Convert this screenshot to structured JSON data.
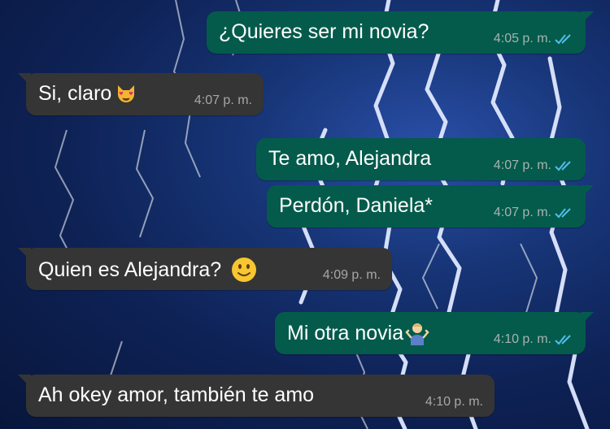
{
  "messages": [
    {
      "direction": "out",
      "text": "¿Quieres ser mi novia?",
      "time": "4:05 p. m.",
      "status": "read",
      "emoji": null
    },
    {
      "direction": "in",
      "text": "Si, claro",
      "time": "4:07 p. m.",
      "emoji": "heart-eyes-cat"
    },
    {
      "direction": "out",
      "text": "Te amo, Alejandra",
      "time": "4:07 p. m.",
      "status": "read",
      "emoji": null
    },
    {
      "direction": "out",
      "text": "Perdón, Daniela*",
      "time": "4:07 p. m.",
      "status": "read",
      "emoji": null
    },
    {
      "direction": "in",
      "text": "Quien es Alejandra?",
      "time": "4:09 p. m.",
      "emoji": "slightly-smiling-face"
    },
    {
      "direction": "out",
      "text": "Mi otra novia",
      "time": "4:10 p. m.",
      "status": "read",
      "emoji": "person-shrugging"
    },
    {
      "direction": "in",
      "text": "Ah okey amor, también te amo",
      "time": "4:10 p. m.",
      "emoji": null
    }
  ],
  "colors": {
    "incoming_bubble": "#353535",
    "outgoing_bubble": "#045b4b",
    "read_ticks": "#53bdeb",
    "wallpaper": "#173577"
  }
}
